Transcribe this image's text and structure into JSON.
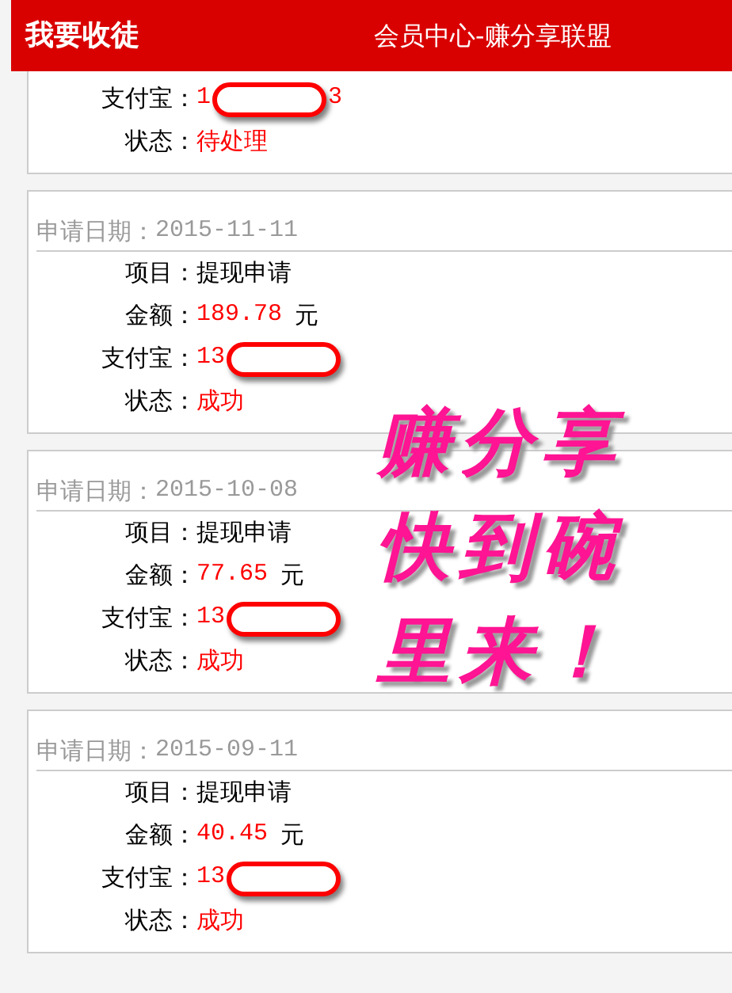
{
  "header": {
    "left_title": "我要收徒",
    "title": "会员中心-赚分享联盟"
  },
  "records": [
    {
      "rows": [
        {
          "kind": "alipay",
          "label": "支付宝：",
          "prefix": "1",
          "suffix": "3"
        },
        {
          "kind": "status",
          "label": "状态：",
          "value": "待处理"
        }
      ]
    },
    {
      "date_label": "申请日期：",
      "date": "2015-11-11",
      "rows": [
        {
          "kind": "item",
          "label": "项目：",
          "value": "提现申请"
        },
        {
          "kind": "amount",
          "label": "金额：",
          "value": "189.78",
          "unit": "元"
        },
        {
          "kind": "alipay",
          "label": "支付宝：",
          "prefix": "13"
        },
        {
          "kind": "status",
          "label": "状态：",
          "value": "成功"
        }
      ]
    },
    {
      "date_label": "申请日期：",
      "date": "2015-10-08",
      "rows": [
        {
          "kind": "item",
          "label": "项目：",
          "value": "提现申请"
        },
        {
          "kind": "amount",
          "label": "金额：",
          "value": "77.65",
          "unit": "元"
        },
        {
          "kind": "alipay",
          "label": "支付宝：",
          "prefix": "13"
        },
        {
          "kind": "status",
          "label": "状态：",
          "value": "成功"
        }
      ]
    },
    {
      "date_label": "申请日期：",
      "date": "2015-09-11",
      "rows": [
        {
          "kind": "item",
          "label": "项目：",
          "value": "提现申请"
        },
        {
          "kind": "amount",
          "label": "金额：",
          "value": "40.45",
          "unit": "元"
        },
        {
          "kind": "alipay",
          "label": "支付宝：",
          "prefix": "13"
        },
        {
          "kind": "status",
          "label": "状态：",
          "value": "成功"
        }
      ]
    }
  ],
  "promo_overlay": [
    "赚分享",
    "快到碗",
    "里来！"
  ]
}
